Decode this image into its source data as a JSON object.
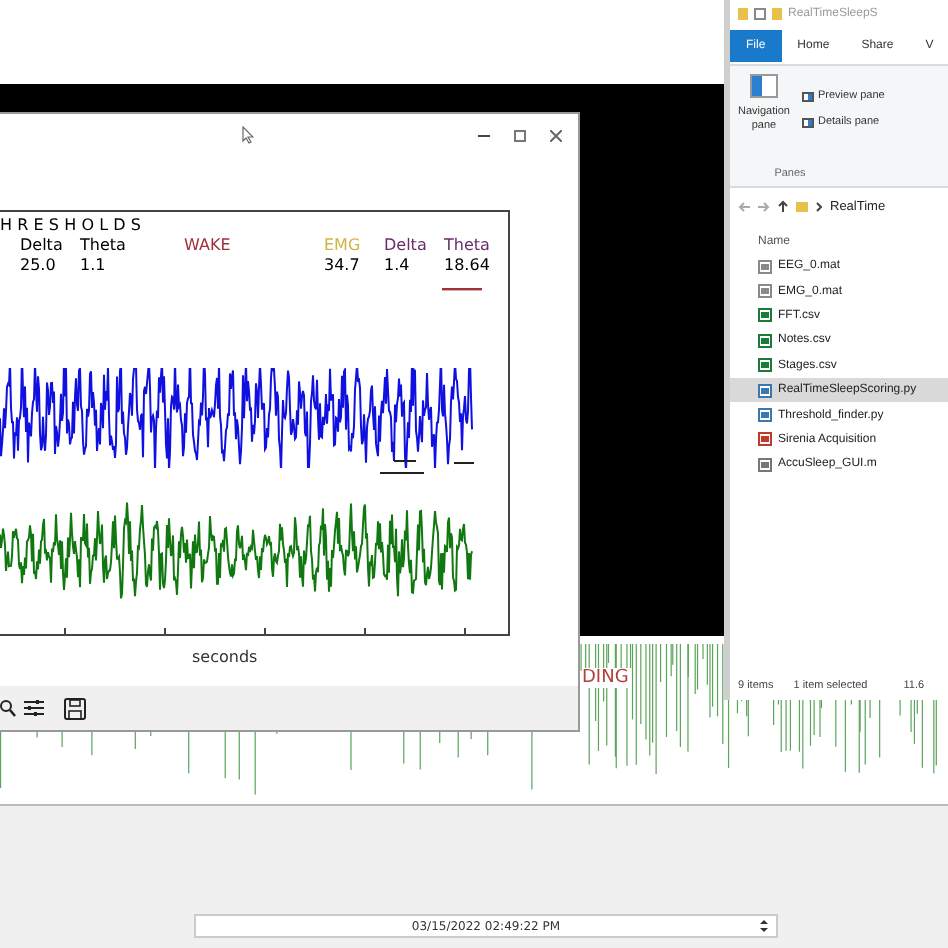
{
  "explorer": {
    "title": "RealTimeSleepS",
    "tabs": [
      {
        "label": "File",
        "selected": true
      },
      {
        "label": "Home",
        "selected": false
      },
      {
        "label": "Share",
        "selected": false
      },
      {
        "label": "V",
        "selected": false
      }
    ],
    "panes": [
      {
        "label": "Preview pane"
      },
      {
        "label": "Details pane"
      }
    ],
    "navigation_pane": "Navigation pane",
    "group": "Panes",
    "path": "RealTime",
    "column": "Name",
    "files": [
      {
        "name": "EEG_0.mat",
        "kind": "mat",
        "selected": false
      },
      {
        "name": "EMG_0.mat",
        "kind": "mat",
        "selected": false
      },
      {
        "name": "FFT.csv",
        "kind": "csv",
        "selected": false
      },
      {
        "name": "Notes.csv",
        "kind": "csv",
        "selected": false
      },
      {
        "name": "Stages.csv",
        "kind": "csv",
        "selected": false
      },
      {
        "name": "RealTimeSleepScoring.py",
        "kind": "py",
        "selected": true
      },
      {
        "name": "Threshold_finder.py",
        "kind": "py",
        "selected": false
      },
      {
        "name": "Sirenia Acquisition",
        "kind": "app",
        "selected": false
      },
      {
        "name": "AccuSleep_GUI.m",
        "kind": "m",
        "selected": false
      }
    ],
    "status": [
      "9 items",
      "1 item selected",
      "11.6"
    ]
  },
  "plot_window": {
    "thresholds_title": "HRESHOLDS",
    "state": "WAKE",
    "xlabel": "seconds",
    "left": [
      {
        "name": "Delta",
        "value": "25.0"
      },
      {
        "name": "Theta",
        "value": "1.1"
      }
    ],
    "right": [
      {
        "name": "EMG",
        "value": "34.7",
        "color": "#d4b24a"
      },
      {
        "name": "Delta",
        "value": "1.4",
        "color": "#6a2c6a"
      },
      {
        "name": "Theta",
        "value": "18.64",
        "color": "#6a2c6a"
      }
    ]
  },
  "background_app": {
    "label": "DING",
    "date_field": {
      "value": "03/15/2022 02:49:22 PM"
    }
  }
}
